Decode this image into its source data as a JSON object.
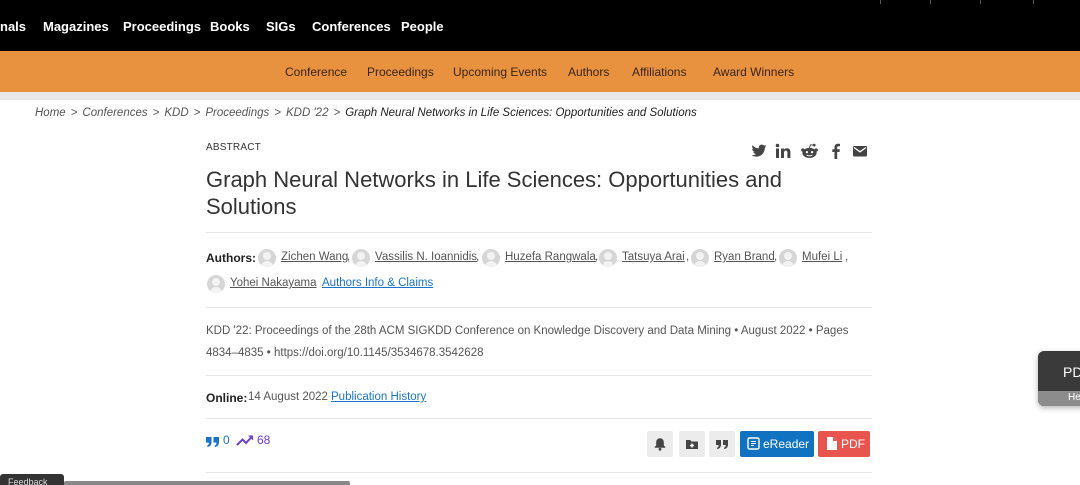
{
  "top_nav": [
    "nals",
    "Magazines",
    "Proceedings",
    "Books",
    "SIGs",
    "Conferences",
    "People"
  ],
  "sub_nav": [
    "Conference",
    "Proceedings",
    "Upcoming Events",
    "Authors",
    "Affiliations",
    "Award Winners"
  ],
  "breadcrumb": {
    "items": [
      "Home",
      "Conferences",
      "KDD",
      "Proceedings",
      "KDD '22"
    ],
    "separator": ">",
    "current": "Graph Neural Networks in Life Sciences: Opportunities and Solutions"
  },
  "article": {
    "type_label": "ABSTRACT",
    "title": "Graph Neural Networks in Life Sciences: Opportunities and Solutions",
    "authors_label": "Authors:",
    "authors": [
      "Zichen Wang",
      "Vassilis N. Ioannidis",
      "Huzefa Rangwala",
      "Tatsuya Arai",
      "Ryan Brand",
      "Mufei Li",
      "Yohei Nakayama"
    ],
    "authors_info_link": "Authors Info & Claims",
    "pub_info_line1": "KDD '22: Proceedings of the 28th ACM SIGKDD Conference on Knowledge Discovery and Data Mining • August 2022 • Pages",
    "pub_info_line2": "4834–4835 • https://doi.org/10.1145/3534678.3542628",
    "online_label": "Online:",
    "online_date": "14 August 2022",
    "publication_history_link": "Publication History",
    "citations": "0",
    "downloads": "68"
  },
  "share_icons": [
    "twitter-icon",
    "linkedin-icon",
    "reddit-icon",
    "facebook-icon",
    "email-icon"
  ],
  "actions": {
    "ereader_label": "eReader",
    "pdf_label": "PDF"
  },
  "side_widget": {
    "label": "PD",
    "sub_label": "He"
  },
  "feedback_label": "Feedback",
  "colors": {
    "top_nav_bg": "#000000",
    "sub_nav_bg": "#e8923f",
    "link": "#1a73c8",
    "ereader_bg": "#1072c0",
    "pdf_bg": "#e8554e"
  }
}
